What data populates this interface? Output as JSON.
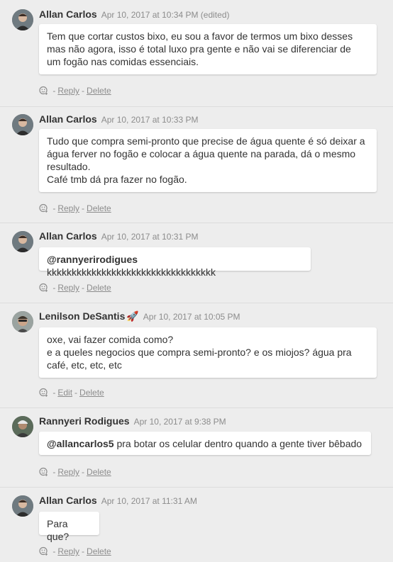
{
  "comments": [
    {
      "author": "Allan Carlos",
      "emoji": "",
      "timestamp": "Apr 10, 2017 at 10:34 PM (edited)",
      "lines": [
        "Tem que cortar custos bixo, eu sou a favor de termos um bixo desses",
        "mas não agora, isso é total luxo pra gente e não vai se diferenciar de",
        "um fogão nas comidas essenciais."
      ],
      "actions": [
        "Reply",
        "Delete"
      ]
    },
    {
      "author": "Allan Carlos",
      "emoji": "",
      "timestamp": "Apr 10, 2017 at 10:33 PM",
      "lines": [
        "Tudo que compra semi-pronto que precise de água quente é só deixar a",
        "água ferver no fogão e colocar a água quente na parada, dá o mesmo",
        "resultado.",
        "Café tmb dá pra fazer no fogão."
      ],
      "actions": [
        "Reply",
        "Delete"
      ]
    },
    {
      "author": "Allan Carlos",
      "emoji": "",
      "timestamp": "Apr 10, 2017 at 10:31 PM",
      "mention": "@rannyerirodigues",
      "lines": [
        "kkkkkkkkkkkkkkkkkkkkkkkkkkkkkkkkkk"
      ],
      "actions": [
        "Reply",
        "Delete"
      ]
    },
    {
      "author": "Lenilson DeSantis",
      "emoji": "🚀",
      "timestamp": "Apr 10, 2017 at 10:05 PM",
      "lines": [
        "oxe, vai fazer comida como?",
        "e a queles negocios que compra semi-pronto? e os miojos? água pra",
        "café, etc, etc, etc"
      ],
      "actions": [
        "Edit",
        "Delete"
      ]
    },
    {
      "author": "Rannyeri Rodigues",
      "emoji": "",
      "timestamp": "Apr 10, 2017 at 9:38 PM",
      "mention": "@allancarlos5",
      "lines": [
        "pra botar os celular dentro quando a gente tiver bêbado"
      ],
      "actions": [
        "Reply",
        "Delete"
      ]
    },
    {
      "author": "Allan Carlos",
      "emoji": "",
      "timestamp": "Apr 10, 2017 at 11:31 AM",
      "lines": [
        "Para que?"
      ],
      "actions": [
        "Reply",
        "Delete"
      ]
    }
  ],
  "icons": {
    "reaction": "add-reaction-icon"
  },
  "colors": {
    "background": "#ededed",
    "bubble": "#ffffff",
    "muted": "#8c8c8c"
  }
}
